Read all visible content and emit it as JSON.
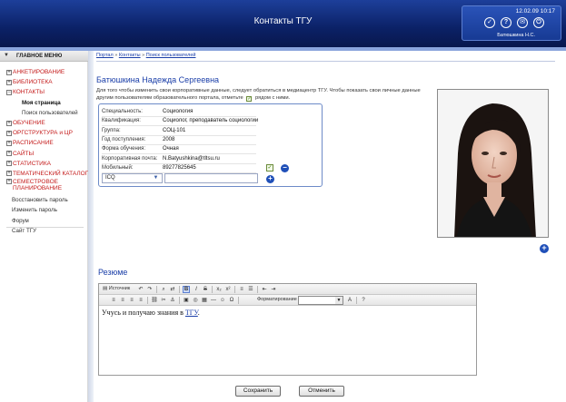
{
  "header": {
    "title": "Контакты ТГУ",
    "datetime": "12.02.09 10:17",
    "user_name": "Батюшкина Н.С.",
    "icons": [
      "check-icon",
      "help-icon",
      "mail-icon",
      "power-icon"
    ],
    "icon_glyphs": [
      "✓",
      "?",
      "✉",
      "⏻"
    ]
  },
  "sidebar": {
    "title": "ГЛАВНОЕ МЕНЮ",
    "items": [
      {
        "label": "АНКЕТИРОВАНИЕ",
        "type": "top",
        "box": "+"
      },
      {
        "label": "БИБЛИОТЕКА",
        "type": "top",
        "box": "+"
      },
      {
        "label": "КОНТАКТЫ",
        "type": "top",
        "box": "−"
      },
      {
        "label": "Моя страница",
        "type": "sub-bold"
      },
      {
        "label": "Поиск пользователей",
        "type": "sub"
      },
      {
        "label": "ОБУЧЕНИЕ",
        "type": "top",
        "box": "+"
      },
      {
        "label": "ОРГСТРУКТУРА и ЦР",
        "type": "top",
        "box": "+"
      },
      {
        "label": "РАСПИСАНИЕ",
        "type": "top",
        "box": "+"
      },
      {
        "label": "САЙТЫ",
        "type": "top",
        "box": "+"
      },
      {
        "label": "СТАТИСТИКА",
        "type": "top",
        "box": "+"
      },
      {
        "label": "ТЕМАТИЧЕСКИЙ КАТАЛОГ",
        "type": "top",
        "box": "+"
      },
      {
        "label": "СЕМЕСТРОВОЕ ПЛАНИРОВАНИЕ",
        "type": "top-two",
        "box": "+"
      },
      {
        "label": "Восстановить пароль",
        "type": "plain"
      },
      {
        "label": "Изменить пароль",
        "type": "plain"
      },
      {
        "label": "Форум",
        "type": "plain"
      },
      {
        "label": "Сайт ТГУ",
        "type": "plain"
      }
    ]
  },
  "breadcrumb": {
    "items": [
      "Портал",
      "Контакты",
      "Поиск пользователей"
    ],
    "separator": "»"
  },
  "profile": {
    "name": "Батюшкина Надежда Сергеевна",
    "note_before": "Для того чтобы изменить свои корпоративные данные, следует обратиться в медиацентр ТГУ. Чтобы показать свои личные данные другим пользователям образовательного портала, отметьте",
    "note_after": "рядом с ними.",
    "fields": [
      {
        "label": "Специальность:",
        "value": "Социология"
      },
      {
        "label": "Квалификация:",
        "value": "Социолог, преподаватель социологии"
      },
      {
        "label": "Группа:",
        "value": "СОЦ-101"
      },
      {
        "label": "Год поступления:",
        "value": "2008"
      },
      {
        "label": "Форма обучения:",
        "value": "Очная"
      },
      {
        "label": "Корпоративная почта:",
        "value": "N.Batyushkina@tltsu.ru"
      },
      {
        "label": "Мобильный:",
        "value": "89277825645"
      }
    ],
    "im_type": "ICQ",
    "im_value": ""
  },
  "resume": {
    "title": "Резюме",
    "toolbar_source": "Источник",
    "toolbar_format": "Форматирование",
    "content_text": "Учусь и получаю знания в ",
    "content_link": "ТГУ",
    "content_end": "."
  },
  "actions": {
    "save_label": "Сохранить",
    "cancel_label": "Отменить"
  },
  "colors": {
    "header_bg": "#0b2166",
    "accent_blue": "#1a3ea8",
    "menu_red": "#c41a1a"
  }
}
